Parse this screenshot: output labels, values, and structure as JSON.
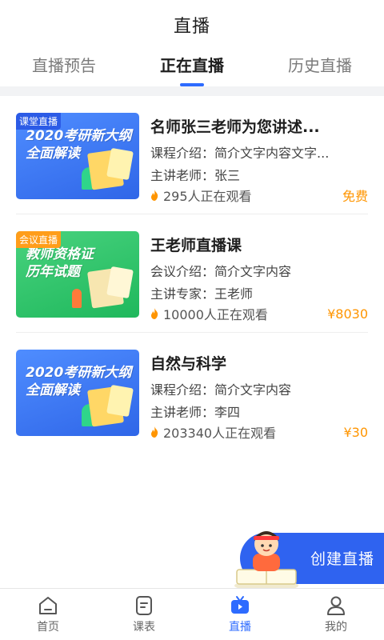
{
  "header": {
    "title": "直播"
  },
  "tabs": [
    {
      "label": "直播预告"
    },
    {
      "label": "正在直播"
    },
    {
      "label": "历史直播"
    }
  ],
  "colors": {
    "accent": "#2d6bff",
    "price": "#ff9500",
    "flame": "#ff9500"
  },
  "cards": [
    {
      "thumb_badge": "课堂直播",
      "thumb_text_1": "2020考研新大纲",
      "thumb_text_2": "全面解读",
      "title": "名师张三老师为您讲述...",
      "line1_label": "课程介绍：",
      "line1_value": "简介文字内容文字...",
      "line2_label": "主讲老师：",
      "line2_value": "张三",
      "viewers": "295人正在观看",
      "price": "免费"
    },
    {
      "thumb_badge": "会议直播",
      "thumb_text_1": "教师资格证",
      "thumb_text_2": "历年试题",
      "title": "王老师直播课",
      "line1_label": "会议介绍：",
      "line1_value": "简介文字内容",
      "line2_label": "主讲专家：",
      "line2_value": "王老师",
      "viewers": "10000人正在观看",
      "price": "¥8030"
    },
    {
      "thumb_badge": "",
      "thumb_text_1": "2020考研新大纲",
      "thumb_text_2": "全面解读",
      "title": "自然与科学",
      "line1_label": "课程介绍：",
      "line1_value": "简介文字内容",
      "line2_label": "主讲老师：",
      "line2_value": "李四",
      "viewers": "203340人正在观看",
      "price": "¥30"
    }
  ],
  "fab": {
    "label": "创建直播"
  },
  "tabbar": [
    {
      "label": "首页",
      "icon": "home-icon"
    },
    {
      "label": "课表",
      "icon": "schedule-icon"
    },
    {
      "label": "直播",
      "icon": "live-tv-icon"
    },
    {
      "label": "我的",
      "icon": "profile-icon"
    }
  ]
}
